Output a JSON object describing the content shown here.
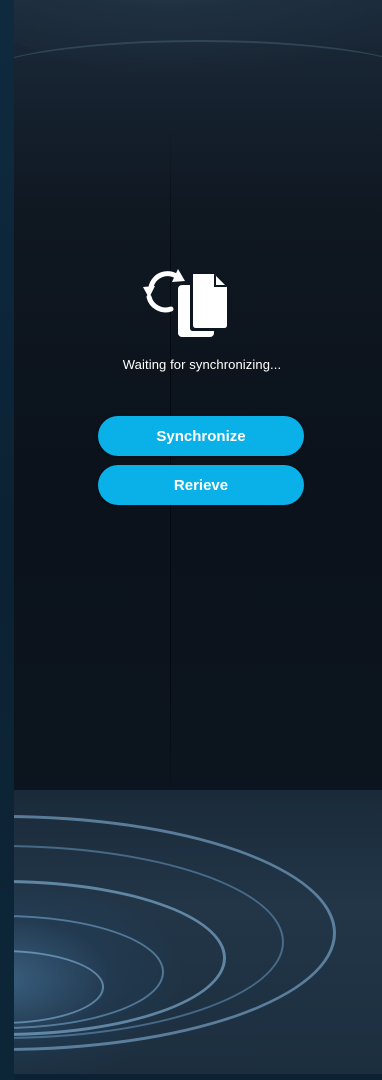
{
  "status": {
    "message": "Waiting for synchronizing...",
    "icon": "sync-document-icon"
  },
  "actions": {
    "synchronize_label": "Synchronize",
    "retrieve_label": "Rerieve"
  },
  "colors": {
    "accent": "#0ab0e8",
    "text": "#ffffff",
    "background": "#0c141e",
    "edge": "#0b2234"
  }
}
